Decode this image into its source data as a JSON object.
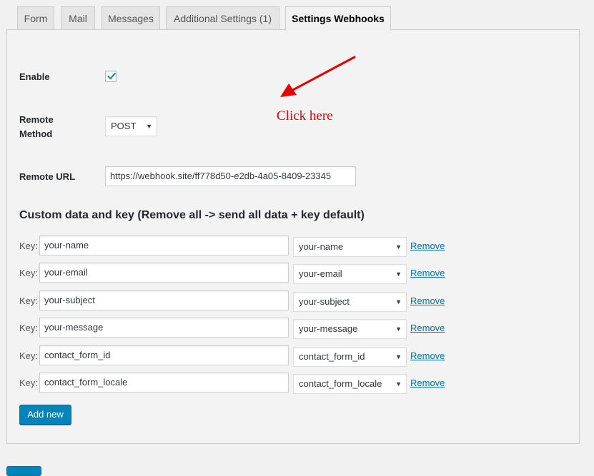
{
  "tabs": [
    {
      "label": "Form",
      "active": false
    },
    {
      "label": "Mail",
      "active": false
    },
    {
      "label": "Messages",
      "active": false
    },
    {
      "label": "Additional Settings (1)",
      "active": false
    },
    {
      "label": "Settings Webhooks",
      "active": true
    }
  ],
  "settings": {
    "enable_label": "Enable",
    "enable_checked": true,
    "method_label_line1": "Remote",
    "method_label_line2": "Method",
    "method_value": "POST",
    "url_label": "Remote URL",
    "url_value": "https://webhook.site/ff778d50-e2db-4a05-8409-23345"
  },
  "annotation": {
    "text": "Click here",
    "color": "#e60000"
  },
  "custom": {
    "heading": "Custom data and key (Remove all -> send all data + key default)",
    "key_prefix": "Key:",
    "remove_label": "Remove",
    "rows": [
      {
        "key": "your-name",
        "value": "your-name"
      },
      {
        "key": "your-email",
        "value": "your-email"
      },
      {
        "key": "your-subject",
        "value": "your-subject"
      },
      {
        "key": "your-message",
        "value": "your-message"
      },
      {
        "key": "contact_form_id",
        "value": "contact_form_id"
      },
      {
        "key": "contact_form_locale",
        "value": "contact_form_locale"
      }
    ],
    "add_new_label": "Add new"
  },
  "colors": {
    "primary": "#0085ba",
    "link": "#0073aa"
  }
}
